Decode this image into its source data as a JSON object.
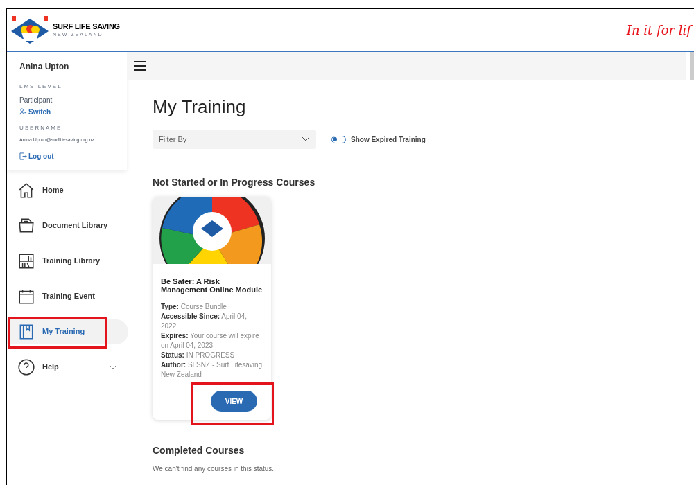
{
  "header": {
    "logo_title": "SURF LIFE SAVING",
    "logo_subtitle": "NEW ZEALAND",
    "tagline": "In it for lif"
  },
  "profile": {
    "name": "Anina Upton",
    "level_label": "LMS LEVEL",
    "level": "Participant",
    "switch": "Switch",
    "username_label": "USERNAME",
    "username": "Anina.Upton@surflifesaving.org.nz",
    "logout": "Log out"
  },
  "nav": [
    {
      "label": "Home",
      "selected": false,
      "expandable": false
    },
    {
      "label": "Document Library",
      "selected": false,
      "expandable": false
    },
    {
      "label": "Training Library",
      "selected": false,
      "expandable": false
    },
    {
      "label": "Training Event",
      "selected": false,
      "expandable": false
    },
    {
      "label": "My Training",
      "selected": true,
      "expandable": false
    },
    {
      "label": "Help",
      "selected": false,
      "expandable": true
    }
  ],
  "page": {
    "title": "My Training",
    "filter": {
      "placeholder": "Filter By"
    },
    "toggle": {
      "label": "Show Expired Training",
      "on": false
    }
  },
  "sections": [
    {
      "title": "Not Started or In Progress Courses",
      "courses": [
        {
          "title": "Be Safer: A Risk Management Online Module",
          "fields": [
            {
              "label": "Type:",
              "value": "Course Bundle"
            },
            {
              "label": "Accessible Since:",
              "value": "April 04, 2022"
            },
            {
              "label": "Expires:",
              "value": "Your course will expire on April 04, 2023"
            },
            {
              "label": "Status:",
              "value": "IN PROGRESS"
            },
            {
              "label": "Author:",
              "value": "SLSNZ - Surf Lifesaving New Zealand"
            }
          ],
          "button": "VIEW"
        }
      ]
    },
    {
      "title": "Completed Courses",
      "empty_message": "We can't find any courses in this status."
    }
  ]
}
